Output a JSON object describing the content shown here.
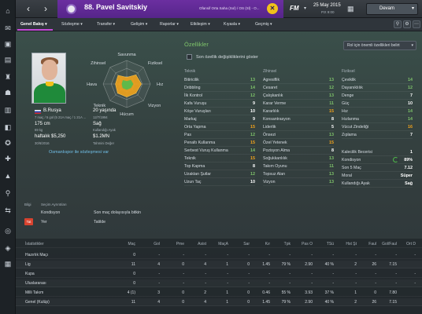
{
  "header": {
    "player_title": "88. Pavel Savitskiy",
    "club_info": "Ofansif Orta Saha (Sol) / OS (Sl) - O...",
    "date": "25 May 2015",
    "day": "Pzt 9:00",
    "continue_label": "Devam"
  },
  "tabs": [
    {
      "label": "Genel Bakış ▾"
    },
    {
      "label": "Sözleşme ▾"
    },
    {
      "label": "Transfer ▾"
    },
    {
      "label": "Gelişim ▾"
    },
    {
      "label": "Raporlar ▾"
    },
    {
      "label": "Etkileşim ▾"
    },
    {
      "label": "Kıyasla ▾"
    },
    {
      "label": "Geçmiş ▾"
    }
  ],
  "radar": {
    "labels": [
      "Savunma",
      "Fiziksel",
      "Hız",
      "Vizyon",
      "Hücum",
      "Teknik",
      "Hava",
      "Zihinsel"
    ],
    "levels": [
      0.28,
      0.55,
      0.62,
      0.55,
      0.55,
      0.55,
      0.48,
      0.52
    ],
    "fill": "#f2a31c"
  },
  "bio": {
    "nation": "B.Rusya",
    "caps_line": "7 maç / 5 gol (5 21A maç / 1 21A ...",
    "age": "20 yaşında",
    "dob": "12/7/1994",
    "height": "175 cm",
    "weight": "69 kg",
    "foot_label": "Sağ",
    "foot_sub": "Kullandığı Ayak",
    "wage": "haftalık $5,250",
    "wage_sub": "30/6/2016",
    "value": "$1.2MN",
    "value_sub": "Tahmini Değer",
    "contract_link": "Osmanlıspor ile sözleşmesi var"
  },
  "attributes": {
    "heading": "Özellikler",
    "checkbox_label": "Son özellik değişikliklerini göster",
    "dropdown": "Rol için önemli özellikleri belirt",
    "columns": [
      {
        "title": "Teknik",
        "rows": [
          {
            "name": "Bitiricilik",
            "value": "13"
          },
          {
            "name": "Dribbling",
            "value": "14"
          },
          {
            "name": "İlk Kontrol",
            "value": "12"
          },
          {
            "name": "Kafa Vuruşu",
            "value": "9"
          },
          {
            "name": "Köşe Vuruşları",
            "value": "10"
          },
          {
            "name": "Markaj",
            "value": "9"
          },
          {
            "name": "Orta Yapma",
            "value": "15"
          },
          {
            "name": "Pas",
            "value": "12"
          },
          {
            "name": "Penaltı Kullanma",
            "value": "15"
          },
          {
            "name": "Serbest Vuruş Kullanma",
            "value": "14"
          },
          {
            "name": "Teknik",
            "value": "15"
          },
          {
            "name": "Top Kapma",
            "value": "8"
          },
          {
            "name": "Uzaktan Şutlar",
            "value": "12"
          },
          {
            "name": "Uzun Taç",
            "value": "10"
          }
        ]
      },
      {
        "title": "Zihinsel",
        "rows": [
          {
            "name": "Agresiflik",
            "value": "13"
          },
          {
            "name": "Cesaret",
            "value": "12"
          },
          {
            "name": "Çalışkanlık",
            "value": "13"
          },
          {
            "name": "Karar Verme",
            "value": "11"
          },
          {
            "name": "Kararlılık",
            "value": "15"
          },
          {
            "name": "Konsantrasyon",
            "value": "8"
          },
          {
            "name": "Liderlik",
            "value": "5"
          },
          {
            "name": "Önsezi",
            "value": "13"
          },
          {
            "name": "Özel Yetenek",
            "value": "15"
          },
          {
            "name": "Pozisyon Alma",
            "value": "8"
          },
          {
            "name": "Soğukkanlılık",
            "value": "13"
          },
          {
            "name": "Takım Oyunu",
            "value": "11"
          },
          {
            "name": "Topsuz Alan",
            "value": "13"
          },
          {
            "name": "Vizyon",
            "value": "13"
          }
        ]
      },
      {
        "title": "Fiziksel",
        "rows": [
          {
            "name": "Çeviklik",
            "value": "14"
          },
          {
            "name": "Dayanıklılık",
            "value": "12"
          },
          {
            "name": "Denge",
            "value": "7"
          },
          {
            "name": "Güç",
            "value": "10"
          },
          {
            "name": "Hız",
            "value": "14"
          },
          {
            "name": "Hızlanma",
            "value": "14"
          },
          {
            "name": "Vücut Zindeliği",
            "value": "16"
          },
          {
            "name": "Zıplama",
            "value": "7"
          }
        ]
      }
    ],
    "extra": [
      {
        "name": "Kalecilik Becerisi",
        "value": "1"
      },
      {
        "name": "Kondisyon",
        "value": "89%"
      },
      {
        "name": "Son 5 Maç",
        "value": "7.12"
      },
      {
        "name": "Moral",
        "value": "Süper"
      },
      {
        "name": "Kullandığı Ayak",
        "value": "Sağ"
      }
    ]
  },
  "status": {
    "head_left": "Bilgi",
    "head_mid": "Seçim Ayrıntıları",
    "row1_mid": "Kondisyon",
    "row1_right": "Son maç dolayısıyla bitkin",
    "row2_mid": "Yer",
    "row2_right": "Tatilde",
    "badge": "Tat"
  },
  "stats": {
    "headers": [
      "İstatistikler",
      "Maç",
      "Gol",
      "Pme",
      "Asist",
      "MaçA",
      "Sar",
      "Kır",
      "Tpk",
      "Pas O",
      "TSü",
      "Hst Şt",
      "Faul",
      "Gol/Faul",
      "Ort D"
    ],
    "rows": [
      [
        "Hazırlık Maçı",
        "0",
        "-",
        "-",
        "-",
        "-",
        "-",
        "-",
        "-",
        "-",
        "-",
        "-",
        "-",
        "-",
        "-"
      ],
      [
        "Lig",
        "11",
        "4",
        "0",
        "4",
        "1",
        "0",
        "1.45",
        "79 %",
        "2.90",
        "40 %",
        "2",
        "26",
        "7.15",
        ""
      ],
      [
        "Kupa",
        "0",
        "-",
        "-",
        "-",
        "-",
        "-",
        "-",
        "-",
        "-",
        "-",
        "-",
        "-",
        "-",
        "-"
      ],
      [
        "Uluslararası",
        "0",
        "-",
        "-",
        "-",
        "-",
        "-",
        "-",
        "-",
        "-",
        "-",
        "-",
        "-",
        "-",
        "-"
      ],
      [
        "Milli Takım",
        "4 (1)",
        "3",
        "0",
        "2",
        "1",
        "0",
        "0.46",
        "55 %",
        "3.93",
        "37 %",
        "1",
        "0",
        "7.80",
        ""
      ],
      [
        "Genel (Kulüp)",
        "11",
        "4",
        "0",
        "4",
        "1",
        "0",
        "1.45",
        "79 %",
        "2.90",
        "40 %",
        "2",
        "26",
        "7.15",
        ""
      ]
    ]
  },
  "colors": {
    "accent_purple": "#6b2fa0",
    "value_green": "#7ec36a",
    "value_orange": "#f2a31c",
    "value_white": "#ffffff"
  }
}
